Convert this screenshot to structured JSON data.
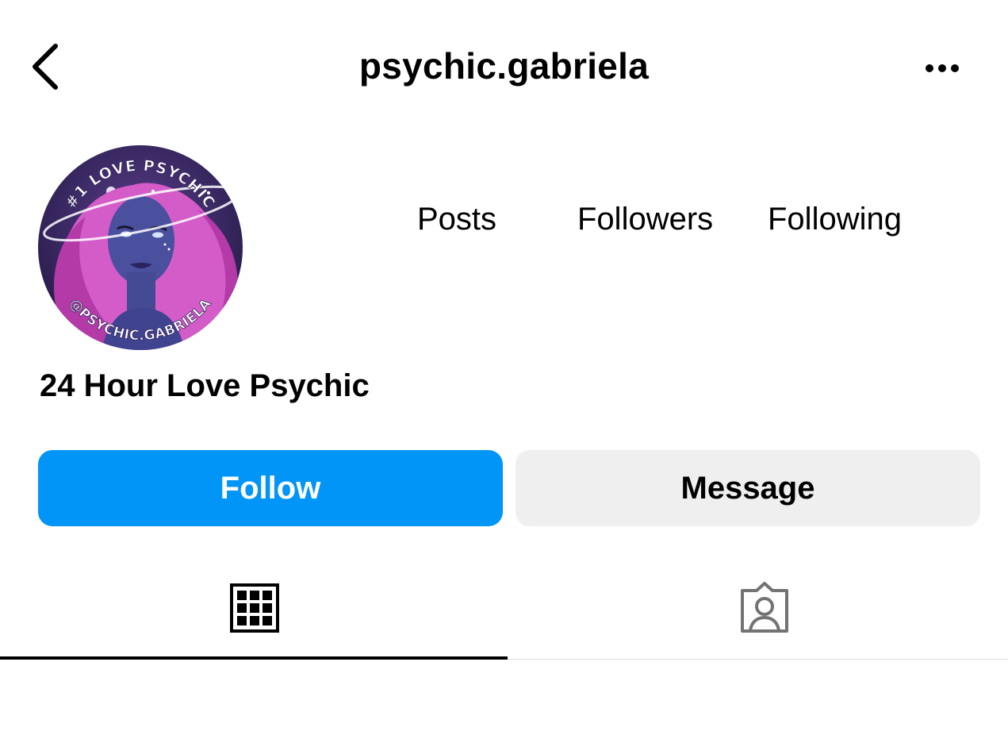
{
  "header": {
    "username": "psychic.gabriela",
    "back_icon": "chevron-left-icon",
    "more_icon": "ellipsis-icon"
  },
  "avatar": {
    "top_text": "#1 LOVE PSYCHIC",
    "bottom_text": "@PSYCHIC.GABRIELA"
  },
  "stats": {
    "posts_label": "Posts",
    "followers_label": "Followers",
    "following_label": "Following"
  },
  "bio": {
    "name": "24 Hour Love Psychic"
  },
  "actions": {
    "follow_label": "Follow",
    "message_label": "Message"
  },
  "tabs": [
    {
      "icon": "grid-icon",
      "active": true
    },
    {
      "icon": "tagged-person-icon",
      "active": false
    }
  ],
  "colors": {
    "accent": "#0095f6",
    "secondary_button": "#efefef",
    "text": "#000000",
    "inactive_icon": "#737373",
    "divider": "#dbdbdb"
  }
}
